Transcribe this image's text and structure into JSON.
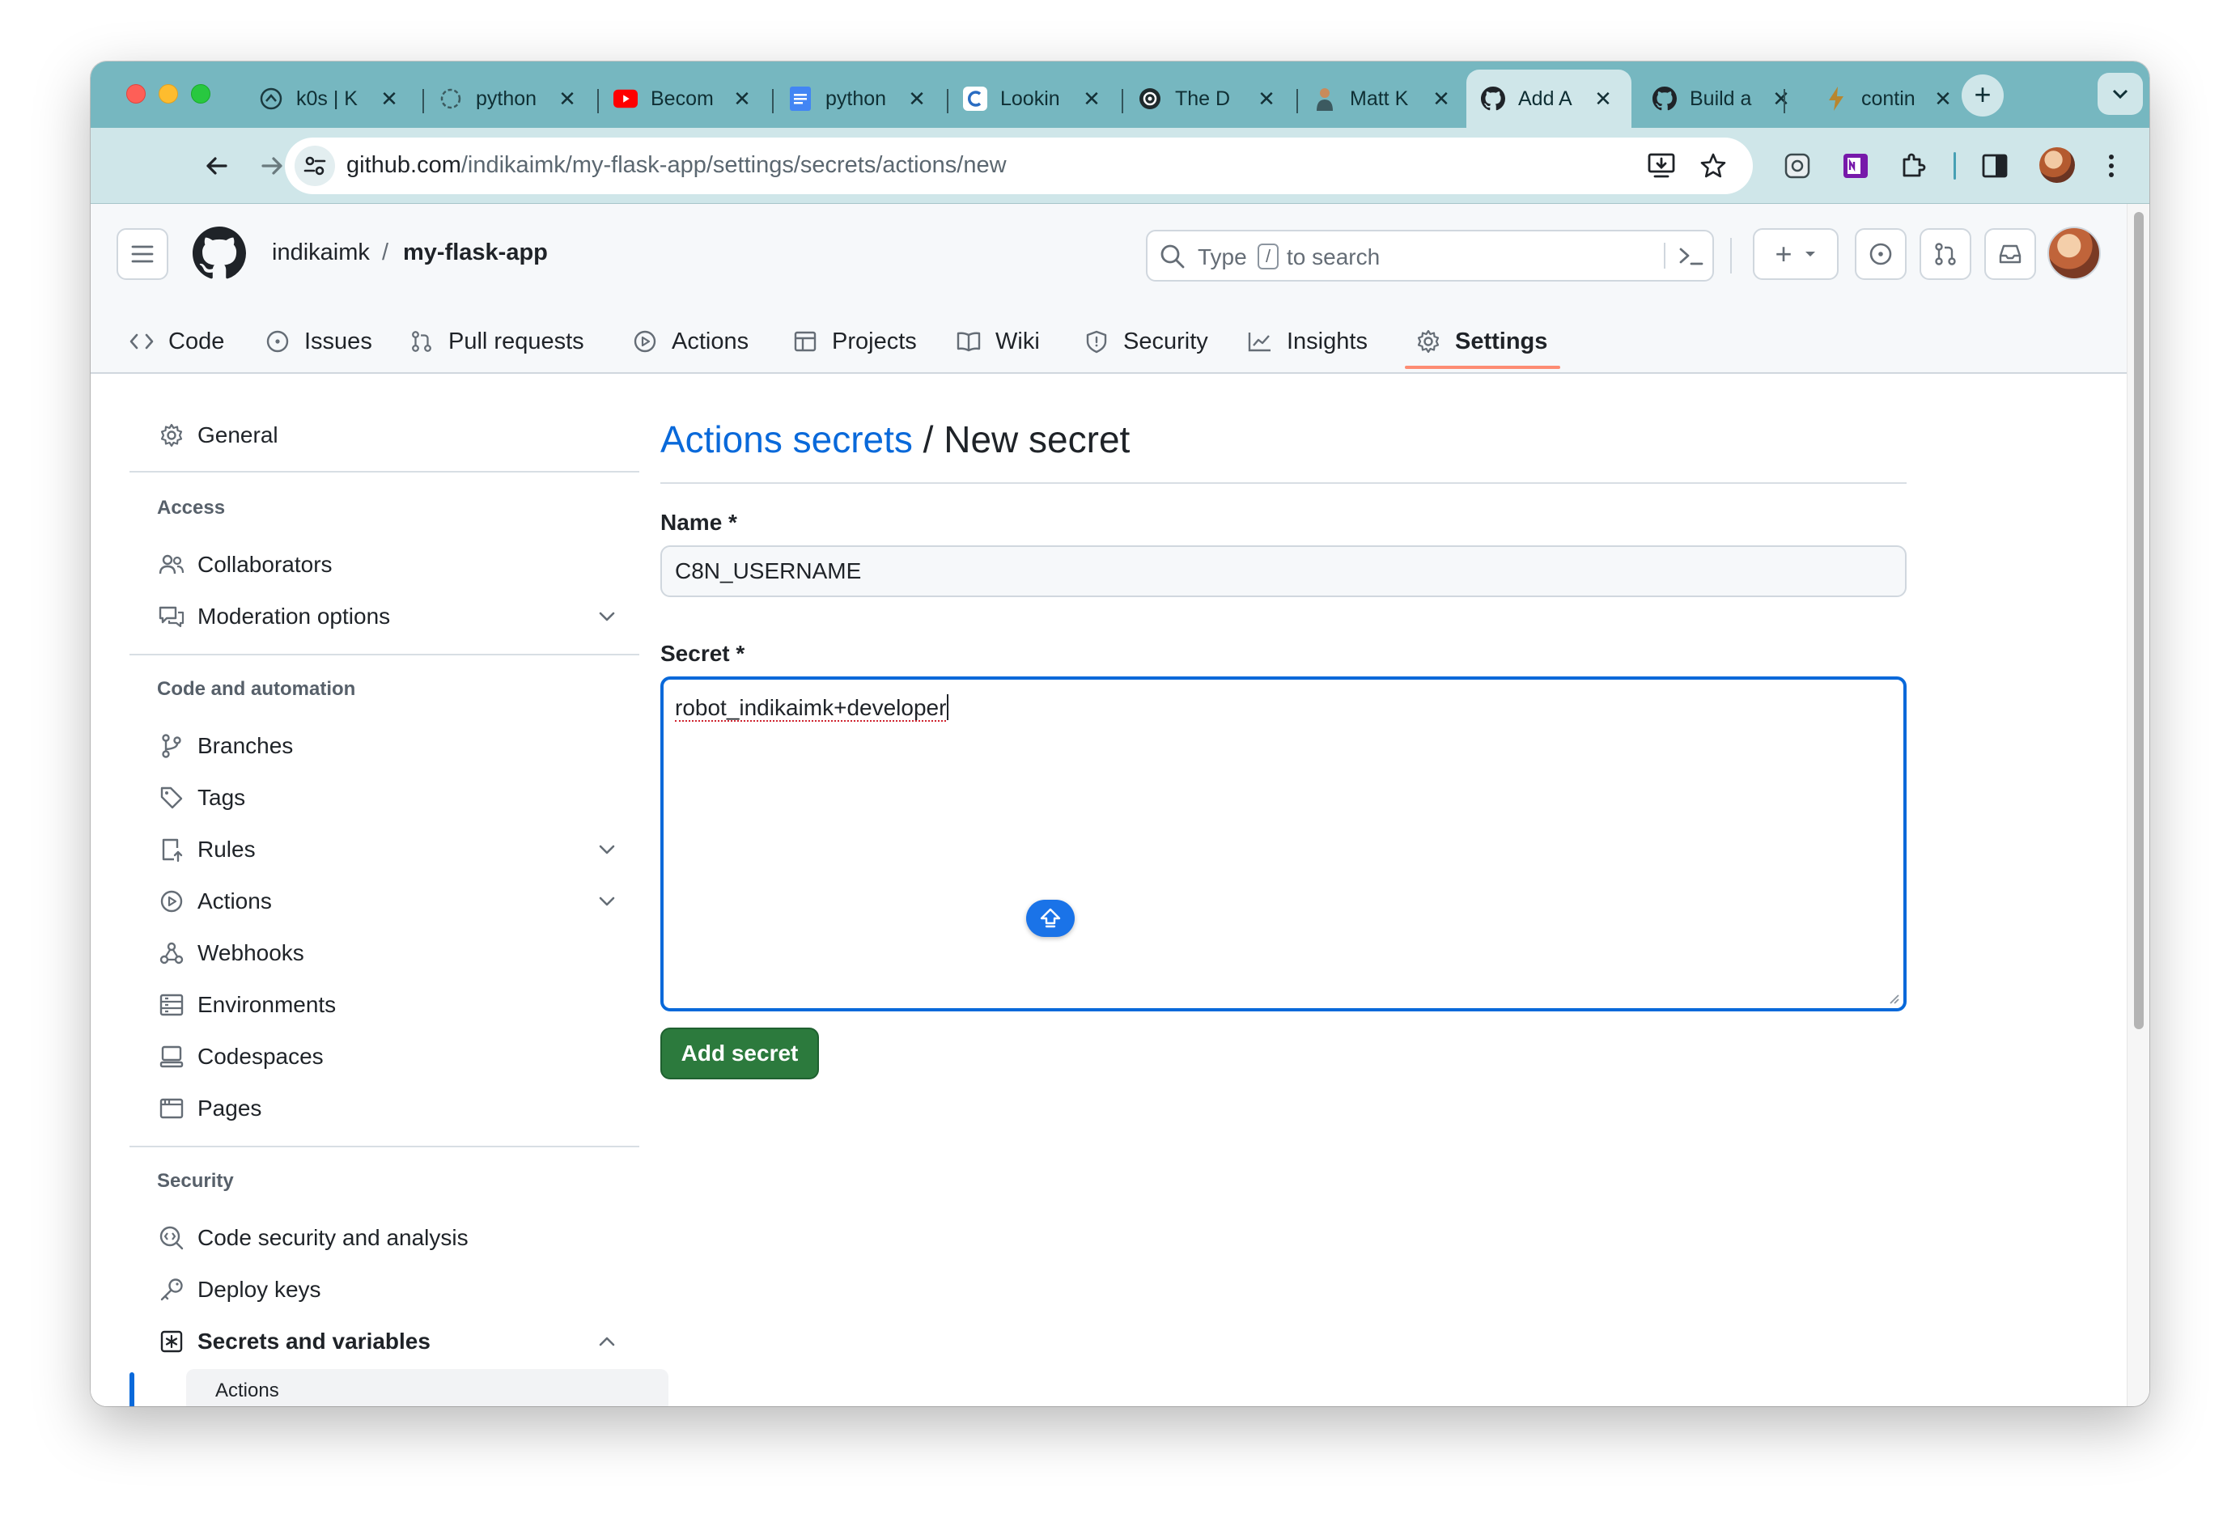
{
  "browser": {
    "tabs": [
      {
        "title": "k0s | K",
        "icon": "gauge-icon"
      },
      {
        "title": "python",
        "icon": "loading-icon"
      },
      {
        "title": "Becom",
        "icon": "youtube-icon"
      },
      {
        "title": "python",
        "icon": "docs-icon"
      },
      {
        "title": "Lookin",
        "icon": "c-letter-icon"
      },
      {
        "title": "The D",
        "icon": "openai-icon"
      },
      {
        "title": "Matt K",
        "icon": "person-icon"
      },
      {
        "title": "Add A",
        "icon": "github-icon",
        "active": true
      },
      {
        "title": "Build a",
        "icon": "github-icon"
      },
      {
        "title": "contin",
        "icon": "bolt-icon"
      }
    ],
    "new_tab_label": "+",
    "close_glyph": "✕",
    "url_host": "github.com",
    "url_path": "/indikaimk/my-flask-app/settings/secrets/actions/new"
  },
  "header": {
    "owner": "indikaimk",
    "separator": "/",
    "repo": "my-flask-app",
    "search_placeholder_pre": "Type",
    "search_key": "/",
    "search_placeholder_post": "to search",
    "plus_label": "+"
  },
  "repo_nav": [
    {
      "label": "Code",
      "icon": "code-icon"
    },
    {
      "label": "Issues",
      "icon": "issue-icon"
    },
    {
      "label": "Pull requests",
      "icon": "pull-request-icon"
    },
    {
      "label": "Actions",
      "icon": "play-icon"
    },
    {
      "label": "Projects",
      "icon": "table-icon"
    },
    {
      "label": "Wiki",
      "icon": "book-icon"
    },
    {
      "label": "Security",
      "icon": "shield-icon"
    },
    {
      "label": "Insights",
      "icon": "graph-icon"
    },
    {
      "label": "Settings",
      "icon": "gear-icon",
      "selected": true
    }
  ],
  "sidebar": {
    "general": "General",
    "access_heading": "Access",
    "collaborators": "Collaborators",
    "moderation": "Moderation options",
    "code_heading": "Code and automation",
    "branches": "Branches",
    "tags": "Tags",
    "rules": "Rules",
    "actions": "Actions",
    "webhooks": "Webhooks",
    "environments": "Environments",
    "codespaces": "Codespaces",
    "pages": "Pages",
    "security_heading": "Security",
    "code_security": "Code security and analysis",
    "deploy_keys": "Deploy keys",
    "secrets": "Secrets and variables",
    "secrets_actions": "Actions"
  },
  "main": {
    "breadcrumb_link": "Actions secrets",
    "breadcrumb_sep": " / ",
    "breadcrumb_current": "New secret",
    "name_label": "Name *",
    "name_value": "C8N_USERNAME",
    "secret_label": "Secret *",
    "secret_value": "robot_indikaimk+developer",
    "submit_label": "Add secret"
  },
  "colors": {
    "link": "#0969da",
    "primary_button": "#2c7a3d",
    "tab_strip": "#76b7c0",
    "selected_underline": "#fd8c73"
  }
}
